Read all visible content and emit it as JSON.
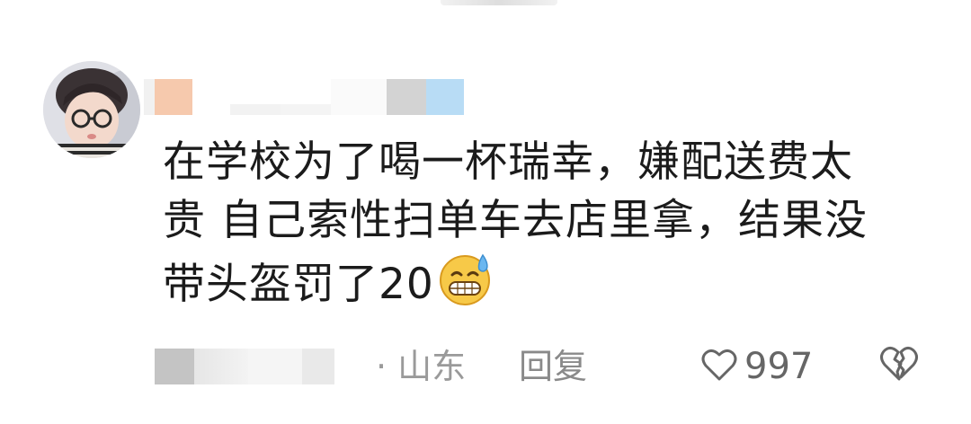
{
  "comment": {
    "text_line1": "在学校为了喝一杯瑞幸，嫌配送费太",
    "text_line2": "贵  自己索性扫单车去店里拿，结果没",
    "text_line3": "带头盔罚了20",
    "emoji": "grinning-face-with-sweat"
  },
  "footer": {
    "location": "· 山东",
    "reply_label": "回复",
    "like_count": "997"
  },
  "colors": {
    "text": "#1b1b1b",
    "meta": "#9a9a9a",
    "icon": "#666666"
  }
}
